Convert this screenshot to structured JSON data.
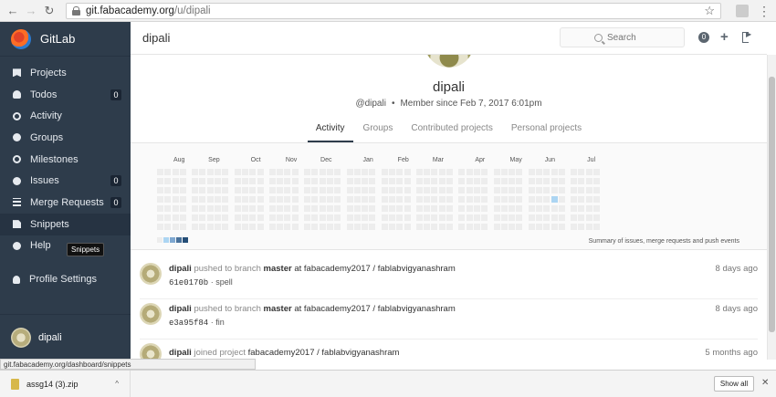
{
  "browser": {
    "url_host": "git.fabacademy.org",
    "url_path": "/u/dipali",
    "back_icon": "arrow-left",
    "forward_icon": "arrow-right",
    "reload_icon": "reload"
  },
  "sidebar": {
    "brand": "GitLab",
    "items": [
      {
        "label": "Projects",
        "icon": "bookmark-icon",
        "count": ""
      },
      {
        "label": "Todos",
        "icon": "bell-icon",
        "count": "0"
      },
      {
        "label": "Activity",
        "icon": "dashboard-icon",
        "count": ""
      },
      {
        "label": "Groups",
        "icon": "group-icon",
        "count": ""
      },
      {
        "label": "Milestones",
        "icon": "clock-icon",
        "count": ""
      },
      {
        "label": "Issues",
        "icon": "exclamation-icon",
        "count": "0"
      },
      {
        "label": "Merge Requests",
        "icon": "list-icon",
        "count": "0"
      },
      {
        "label": "Snippets",
        "icon": "clipboard-icon",
        "count": ""
      },
      {
        "label": "Help",
        "icon": "question-icon",
        "count": ""
      },
      {
        "label": "Profile Settings",
        "icon": "user-icon",
        "count": ""
      }
    ],
    "tooltip": "Snippets",
    "user_name": "dipali"
  },
  "header": {
    "title": "dipali",
    "search_placeholder": "Search",
    "todo_count": "0"
  },
  "profile": {
    "name": "dipali",
    "username": "@dipali",
    "member_since": "Member since Feb 7, 2017 6:01pm",
    "tabs": [
      {
        "label": "Activity",
        "active": true
      },
      {
        "label": "Groups",
        "active": false
      },
      {
        "label": "Contributed projects",
        "active": false
      },
      {
        "label": "Personal projects",
        "active": false
      }
    ]
  },
  "calendar": {
    "months": [
      "Aug",
      "Sep",
      "Oct",
      "Nov",
      "Dec",
      "Jan",
      "Feb",
      "Mar",
      "Apr",
      "May",
      "Jun",
      "Jul"
    ],
    "caption": "Summary of issues, merge requests and push events",
    "legend_colors": [
      "#ededed",
      "#acd5f2",
      "#7fa8d1",
      "#49729b",
      "#254e77"
    ],
    "active_color": "#acd5f2"
  },
  "events": [
    {
      "author": "dipali",
      "action": "pushed to branch",
      "target": "master",
      "preposition": "at",
      "project": "fabacademy2017 / fablabvigyanashram",
      "sha": "61e0170b",
      "sep": "·",
      "message": "spell",
      "time": "8 days ago"
    },
    {
      "author": "dipali",
      "action": "pushed to branch",
      "target": "master",
      "preposition": "at",
      "project": "fabacademy2017 / fablabvigyanashram",
      "sha": "e3a95f84",
      "sep": "·",
      "message": "fin",
      "time": "8 days ago"
    },
    {
      "author": "dipali",
      "action": "joined project",
      "target": "",
      "preposition": "",
      "project": "fabacademy2017 / fablabvigyanashram",
      "sha": "",
      "sep": "",
      "message": "",
      "time": "5 months ago"
    }
  ],
  "statusbar": {
    "text": "git.fabacademy.org/dashboard/snippets"
  },
  "downloads": {
    "file_name": "assg14 (3).zip",
    "show_all": "Show all"
  }
}
